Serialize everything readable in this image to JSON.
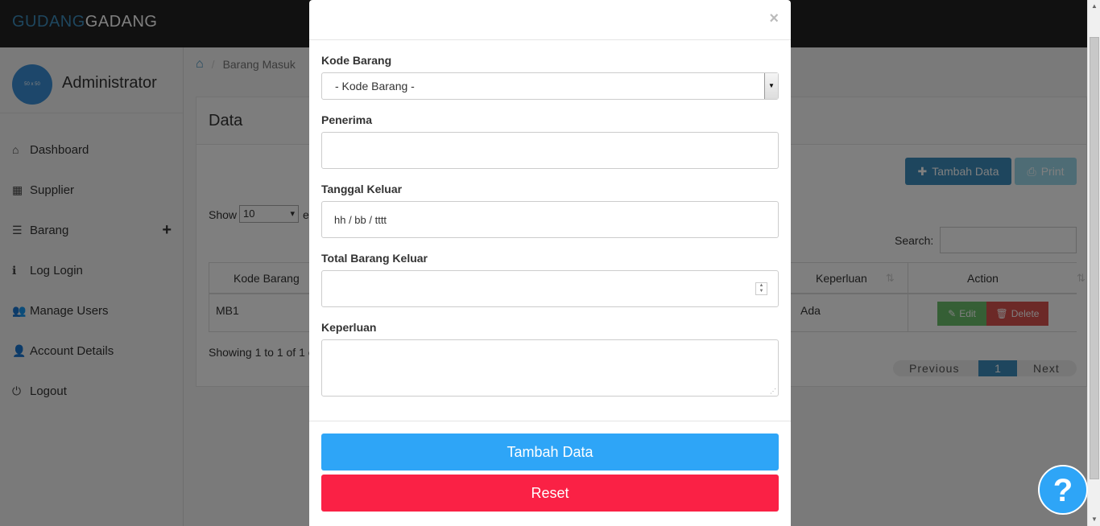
{
  "brand": {
    "part1": "GUDANG",
    "part2": "GADANG"
  },
  "sidebar": {
    "avatar_text": "50 x 50",
    "user_name": "Administrator",
    "items": [
      {
        "icon": "home-icon",
        "label": "Dashboard"
      },
      {
        "icon": "calendar-icon",
        "label": "Supplier"
      },
      {
        "icon": "list-icon",
        "label": "Barang"
      },
      {
        "icon": "info-icon",
        "label": "Log Login"
      },
      {
        "icon": "users-icon",
        "label": "Manage Users"
      },
      {
        "icon": "user-icon",
        "label": "Account Details"
      },
      {
        "icon": "power-icon",
        "label": "Logout"
      }
    ]
  },
  "breadcrumb": {
    "current": "Barang Masuk"
  },
  "panel": {
    "title": "Data",
    "add_label": "Tambah Data",
    "print_label": "Print",
    "show_label": "Show",
    "show_value": "10",
    "entries_partial": "e",
    "search_label": "Search:",
    "columns": [
      "Kode Barang",
      "Keperluan",
      "Action"
    ],
    "row": {
      "kode": "MB1",
      "keperluan": "Ada"
    },
    "edit_label": "Edit",
    "delete_label": "Delete",
    "showing": "Showing 1 to 1 of 1 e",
    "pager": {
      "prev": "Previous",
      "page": "1",
      "next": "Next"
    }
  },
  "modal": {
    "close": "×",
    "kode_label": "Kode Barang",
    "kode_value": "- Kode Barang -",
    "penerima_label": "Penerima",
    "tanggal_label": "Tanggal Keluar",
    "tanggal_value": "hh / bb / tttt",
    "total_label": "Total Barang Keluar",
    "keperluan_label": "Keperluan",
    "submit_label": "Tambah Data",
    "reset_label": "Reset"
  },
  "help": "?",
  "colors": {
    "primary": "#3c8dbc",
    "submit": "#2ea5f7",
    "reset": "#fa2145",
    "edit": "#5cb85c",
    "delete": "#d9534f"
  }
}
